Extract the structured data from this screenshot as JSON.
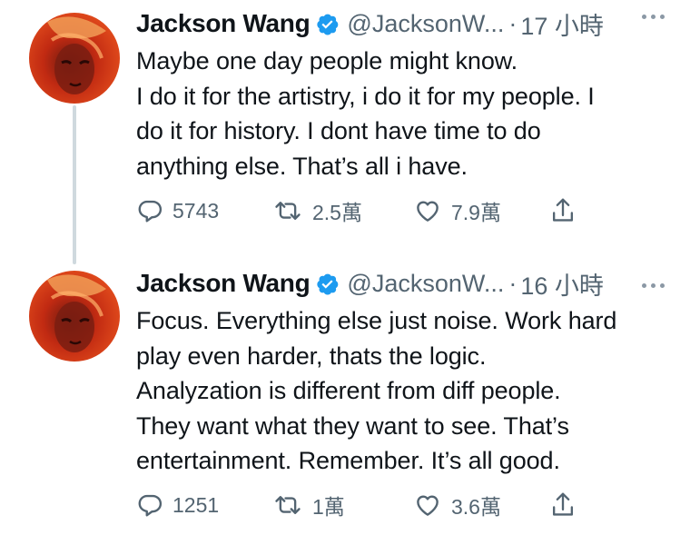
{
  "tweets": [
    {
      "author": {
        "name": "Jackson Wang",
        "handle": "@JacksonW...",
        "verified": true
      },
      "separator": "·",
      "time": "17 小時",
      "text_lines": [
        "Maybe one day people might know.",
        "I do it for the artistry, i do it for my people. I",
        "do it for history. I dont have time to do",
        "anything else. That’s all i have."
      ],
      "actions": {
        "replies": "5743",
        "retweets": "2.5萬",
        "likes": "7.9萬"
      }
    },
    {
      "author": {
        "name": "Jackson Wang",
        "handle": "@JacksonW...",
        "verified": true
      },
      "separator": "·",
      "time": "16 小時",
      "text_lines": [
        "Focus. Everything else just noise. Work hard",
        "play even harder, thats the logic.",
        "Analyzation is different from diff people.",
        "They want what they want to see. That’s",
        "entertainment. Remember. It’s all good."
      ],
      "actions": {
        "replies": "1251",
        "retweets": "1萬",
        "likes": "3.6萬"
      }
    }
  ],
  "icons": {
    "verified": "verified-badge-icon",
    "more": "more-dots-icon",
    "reply": "reply-bubble-icon",
    "retweet": "retweet-icon",
    "like": "heart-icon",
    "share": "share-icon"
  },
  "colors": {
    "text": "#0f1419",
    "secondary": "#536471",
    "verified": "#1d9bf0",
    "thread_line": "#cfd9de"
  }
}
